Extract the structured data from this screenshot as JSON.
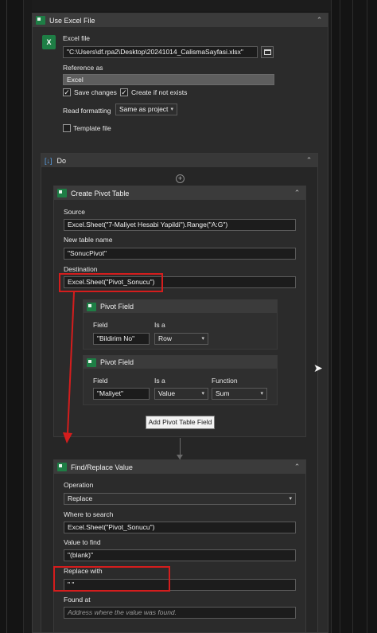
{
  "use_excel_file": {
    "title": "Use Excel File",
    "excel_file_label": "Excel file",
    "excel_file_value": "\"C:\\Users\\df.rpa2\\Desktop\\20241014_CalismaSayfasi.xlsx\"",
    "reference_as_label": "Reference as",
    "reference_as_value": "Excel",
    "save_changes_label": "Save changes",
    "save_changes_checked": true,
    "create_if_not_exists_label": "Create if not exists",
    "create_if_not_exists_checked": true,
    "read_formatting_label": "Read formatting",
    "read_formatting_value": "Same as project",
    "template_file_label": "Template file",
    "template_file_checked": false
  },
  "do_block": {
    "title": "Do"
  },
  "create_pivot_table": {
    "title": "Create Pivot Table",
    "source_label": "Source",
    "source_value": "Excel.Sheet(\"7-Maliyet Hesabi Yapildi\").Range(\"A:G\")",
    "new_table_name_label": "New table name",
    "new_table_name_value": "\"SonucPivot\"",
    "destination_label": "Destination",
    "destination_value": "Excel.Sheet(\"Pivot_Sonucu\")",
    "pivot_fields": [
      {
        "title": "Pivot Field",
        "field_label": "Field",
        "field_value": "\"Bildirim No\"",
        "isa_label": "Is a",
        "isa_value": "Row"
      },
      {
        "title": "Pivot Field",
        "field_label": "Field",
        "field_value": "\"Maliyet\"",
        "isa_label": "Is a",
        "isa_value": "Value",
        "function_label": "Function",
        "function_value": "Sum"
      }
    ],
    "add_field_button": "Add Pivot Table Field"
  },
  "find_replace": {
    "title": "Find/Replace Value",
    "operation_label": "Operation",
    "operation_value": "Replace",
    "where_label": "Where to search",
    "where_value": "Excel.Sheet(\"Pivot_Sonucu\")",
    "value_to_find_label": "Value to find",
    "value_to_find_value": "\"(blank)\"",
    "replace_with_label": "Replace with",
    "replace_with_value": "\" \"",
    "found_at_label": "Found at",
    "found_at_placeholder": "Address where the value was found."
  },
  "icons": {
    "collapse": "chevron-double-up-icon",
    "excel": "excel-icon",
    "browse": "folder-icon",
    "plus": "plus-circle-icon",
    "cursor": "mouse-pointer-icon"
  },
  "colors": {
    "annotation_red": "#d41d1d",
    "excel_green": "#1e7e45",
    "background": "#1a1a1a",
    "panel": "#2b2b2b"
  }
}
